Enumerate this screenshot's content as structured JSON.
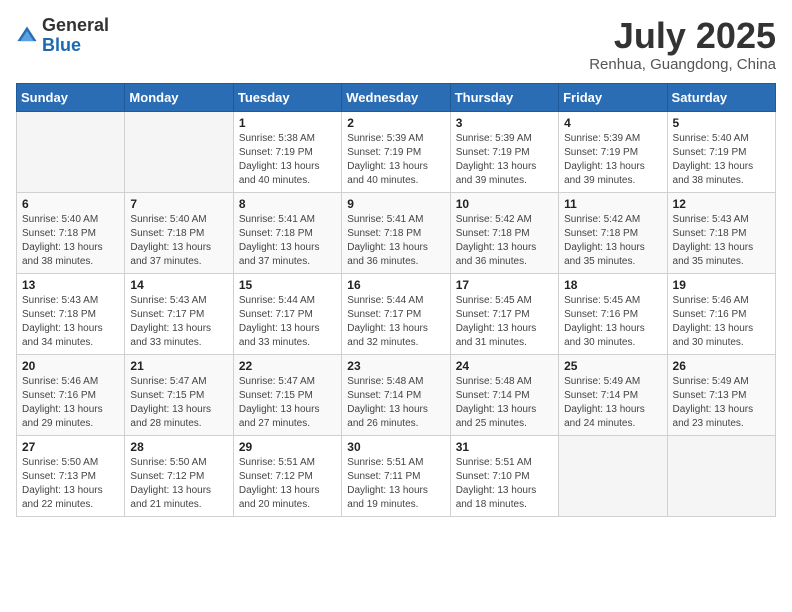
{
  "logo": {
    "general": "General",
    "blue": "Blue"
  },
  "title": {
    "month_year": "July 2025",
    "location": "Renhua, Guangdong, China"
  },
  "days_of_week": [
    "Sunday",
    "Monday",
    "Tuesday",
    "Wednesday",
    "Thursday",
    "Friday",
    "Saturday"
  ],
  "weeks": [
    [
      {
        "day": "",
        "sunrise": "",
        "sunset": "",
        "daylight": ""
      },
      {
        "day": "",
        "sunrise": "",
        "sunset": "",
        "daylight": ""
      },
      {
        "day": "1",
        "sunrise": "Sunrise: 5:38 AM",
        "sunset": "Sunset: 7:19 PM",
        "daylight": "Daylight: 13 hours and 40 minutes."
      },
      {
        "day": "2",
        "sunrise": "Sunrise: 5:39 AM",
        "sunset": "Sunset: 7:19 PM",
        "daylight": "Daylight: 13 hours and 40 minutes."
      },
      {
        "day": "3",
        "sunrise": "Sunrise: 5:39 AM",
        "sunset": "Sunset: 7:19 PM",
        "daylight": "Daylight: 13 hours and 39 minutes."
      },
      {
        "day": "4",
        "sunrise": "Sunrise: 5:39 AM",
        "sunset": "Sunset: 7:19 PM",
        "daylight": "Daylight: 13 hours and 39 minutes."
      },
      {
        "day": "5",
        "sunrise": "Sunrise: 5:40 AM",
        "sunset": "Sunset: 7:19 PM",
        "daylight": "Daylight: 13 hours and 38 minutes."
      }
    ],
    [
      {
        "day": "6",
        "sunrise": "Sunrise: 5:40 AM",
        "sunset": "Sunset: 7:18 PM",
        "daylight": "Daylight: 13 hours and 38 minutes."
      },
      {
        "day": "7",
        "sunrise": "Sunrise: 5:40 AM",
        "sunset": "Sunset: 7:18 PM",
        "daylight": "Daylight: 13 hours and 37 minutes."
      },
      {
        "day": "8",
        "sunrise": "Sunrise: 5:41 AM",
        "sunset": "Sunset: 7:18 PM",
        "daylight": "Daylight: 13 hours and 37 minutes."
      },
      {
        "day": "9",
        "sunrise": "Sunrise: 5:41 AM",
        "sunset": "Sunset: 7:18 PM",
        "daylight": "Daylight: 13 hours and 36 minutes."
      },
      {
        "day": "10",
        "sunrise": "Sunrise: 5:42 AM",
        "sunset": "Sunset: 7:18 PM",
        "daylight": "Daylight: 13 hours and 36 minutes."
      },
      {
        "day": "11",
        "sunrise": "Sunrise: 5:42 AM",
        "sunset": "Sunset: 7:18 PM",
        "daylight": "Daylight: 13 hours and 35 minutes."
      },
      {
        "day": "12",
        "sunrise": "Sunrise: 5:43 AM",
        "sunset": "Sunset: 7:18 PM",
        "daylight": "Daylight: 13 hours and 35 minutes."
      }
    ],
    [
      {
        "day": "13",
        "sunrise": "Sunrise: 5:43 AM",
        "sunset": "Sunset: 7:18 PM",
        "daylight": "Daylight: 13 hours and 34 minutes."
      },
      {
        "day": "14",
        "sunrise": "Sunrise: 5:43 AM",
        "sunset": "Sunset: 7:17 PM",
        "daylight": "Daylight: 13 hours and 33 minutes."
      },
      {
        "day": "15",
        "sunrise": "Sunrise: 5:44 AM",
        "sunset": "Sunset: 7:17 PM",
        "daylight": "Daylight: 13 hours and 33 minutes."
      },
      {
        "day": "16",
        "sunrise": "Sunrise: 5:44 AM",
        "sunset": "Sunset: 7:17 PM",
        "daylight": "Daylight: 13 hours and 32 minutes."
      },
      {
        "day": "17",
        "sunrise": "Sunrise: 5:45 AM",
        "sunset": "Sunset: 7:17 PM",
        "daylight": "Daylight: 13 hours and 31 minutes."
      },
      {
        "day": "18",
        "sunrise": "Sunrise: 5:45 AM",
        "sunset": "Sunset: 7:16 PM",
        "daylight": "Daylight: 13 hours and 30 minutes."
      },
      {
        "day": "19",
        "sunrise": "Sunrise: 5:46 AM",
        "sunset": "Sunset: 7:16 PM",
        "daylight": "Daylight: 13 hours and 30 minutes."
      }
    ],
    [
      {
        "day": "20",
        "sunrise": "Sunrise: 5:46 AM",
        "sunset": "Sunset: 7:16 PM",
        "daylight": "Daylight: 13 hours and 29 minutes."
      },
      {
        "day": "21",
        "sunrise": "Sunrise: 5:47 AM",
        "sunset": "Sunset: 7:15 PM",
        "daylight": "Daylight: 13 hours and 28 minutes."
      },
      {
        "day": "22",
        "sunrise": "Sunrise: 5:47 AM",
        "sunset": "Sunset: 7:15 PM",
        "daylight": "Daylight: 13 hours and 27 minutes."
      },
      {
        "day": "23",
        "sunrise": "Sunrise: 5:48 AM",
        "sunset": "Sunset: 7:14 PM",
        "daylight": "Daylight: 13 hours and 26 minutes."
      },
      {
        "day": "24",
        "sunrise": "Sunrise: 5:48 AM",
        "sunset": "Sunset: 7:14 PM",
        "daylight": "Daylight: 13 hours and 25 minutes."
      },
      {
        "day": "25",
        "sunrise": "Sunrise: 5:49 AM",
        "sunset": "Sunset: 7:14 PM",
        "daylight": "Daylight: 13 hours and 24 minutes."
      },
      {
        "day": "26",
        "sunrise": "Sunrise: 5:49 AM",
        "sunset": "Sunset: 7:13 PM",
        "daylight": "Daylight: 13 hours and 23 minutes."
      }
    ],
    [
      {
        "day": "27",
        "sunrise": "Sunrise: 5:50 AM",
        "sunset": "Sunset: 7:13 PM",
        "daylight": "Daylight: 13 hours and 22 minutes."
      },
      {
        "day": "28",
        "sunrise": "Sunrise: 5:50 AM",
        "sunset": "Sunset: 7:12 PM",
        "daylight": "Daylight: 13 hours and 21 minutes."
      },
      {
        "day": "29",
        "sunrise": "Sunrise: 5:51 AM",
        "sunset": "Sunset: 7:12 PM",
        "daylight": "Daylight: 13 hours and 20 minutes."
      },
      {
        "day": "30",
        "sunrise": "Sunrise: 5:51 AM",
        "sunset": "Sunset: 7:11 PM",
        "daylight": "Daylight: 13 hours and 19 minutes."
      },
      {
        "day": "31",
        "sunrise": "Sunrise: 5:51 AM",
        "sunset": "Sunset: 7:10 PM",
        "daylight": "Daylight: 13 hours and 18 minutes."
      },
      {
        "day": "",
        "sunrise": "",
        "sunset": "",
        "daylight": ""
      },
      {
        "day": "",
        "sunrise": "",
        "sunset": "",
        "daylight": ""
      }
    ]
  ]
}
